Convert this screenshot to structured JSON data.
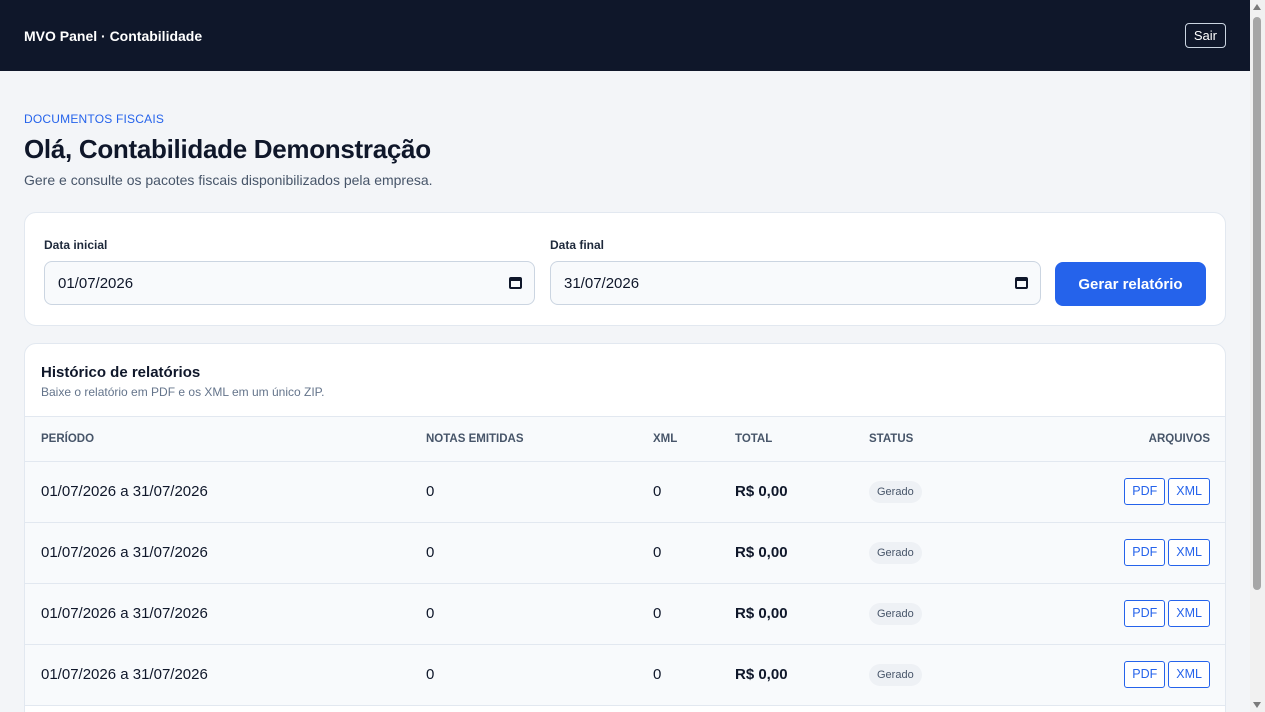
{
  "header": {
    "brand": "MVO Panel · Contabilidade",
    "logout_label": "Sair"
  },
  "page": {
    "eyebrow": "DOCUMENTOS FISCAIS",
    "title": "Olá, Contabilidade Demonstração",
    "subtitle": "Gere e consulte os pacotes fiscais disponibilizados pela empresa."
  },
  "filters": {
    "start_label": "Data inicial",
    "start_value": "01/07/2026",
    "end_label": "Data final",
    "end_value": "31/07/2026",
    "generate_label": "Gerar relatório"
  },
  "history": {
    "title": "Histórico de relatórios",
    "description": "Baixe o relatório em PDF e os XML em um único ZIP.",
    "columns": [
      "PERÍODO",
      "NOTAS EMITIDAS",
      "XML",
      "TOTAL",
      "STATUS",
      "ARQUIVOS"
    ],
    "rows": [
      {
        "period": "01/07/2026 a 31/07/2026",
        "notes": "0",
        "xml": "0",
        "total": "R$ 0,00",
        "status": "Gerado",
        "pdf_label": "PDF",
        "xml_label": "XML"
      },
      {
        "period": "01/07/2026 a 31/07/2026",
        "notes": "0",
        "xml": "0",
        "total": "R$ 0,00",
        "status": "Gerado",
        "pdf_label": "PDF",
        "xml_label": "XML"
      },
      {
        "period": "01/07/2026 a 31/07/2026",
        "notes": "0",
        "xml": "0",
        "total": "R$ 0,00",
        "status": "Gerado",
        "pdf_label": "PDF",
        "xml_label": "XML"
      },
      {
        "period": "01/07/2026 a 31/07/2026",
        "notes": "0",
        "xml": "0",
        "total": "R$ 0,00",
        "status": "Gerado",
        "pdf_label": "PDF",
        "xml_label": "XML"
      }
    ]
  },
  "colors": {
    "topbar": "#0f172a",
    "accent": "#2563eb",
    "background": "#f3f5f8"
  },
  "icons": {
    "date_picker": "calendar-icon"
  }
}
